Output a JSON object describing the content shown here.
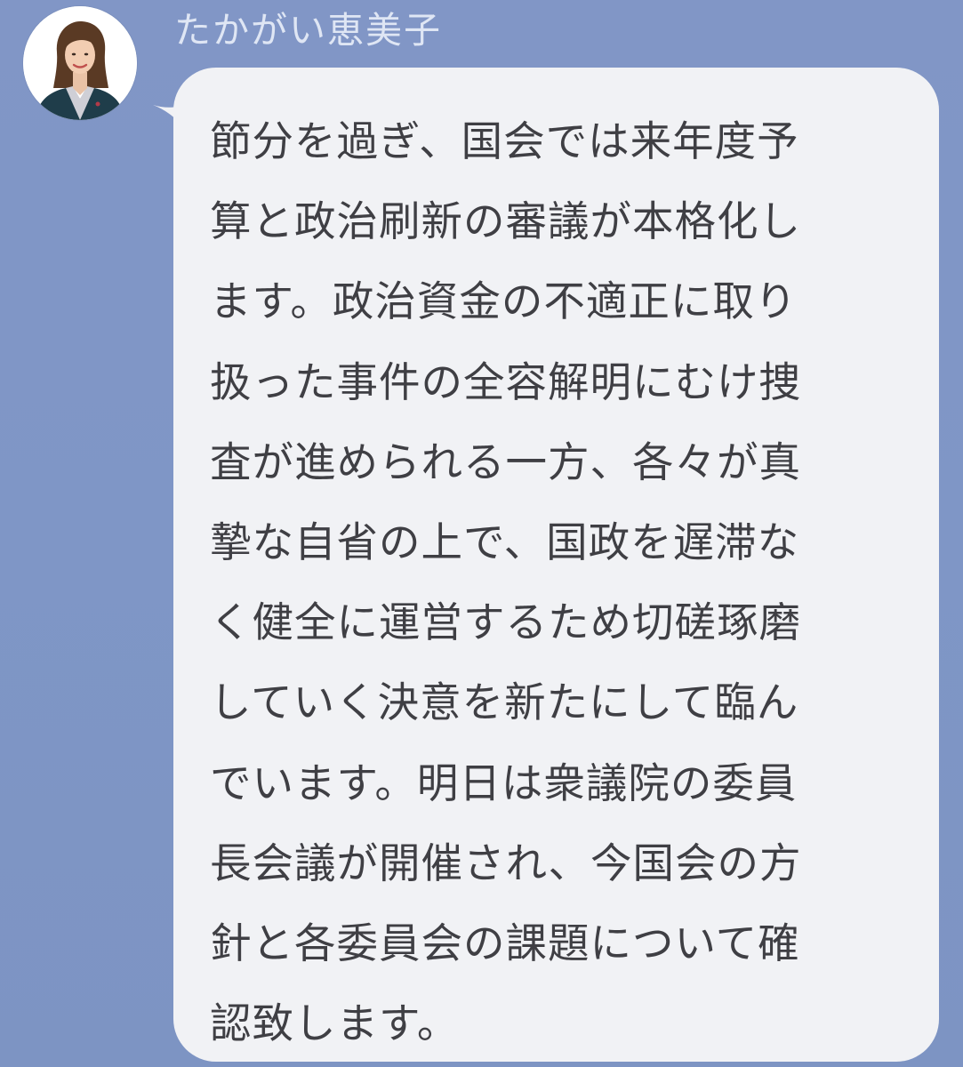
{
  "chat": {
    "sender_name": "たかがい恵美子",
    "message_lines": [
      "節分を過ぎ、国会では来年度予",
      "算と政治刷新の審議が本格化し",
      "ます。政治資金の不適正に取り",
      "扱った事件の全容解明にむけ捜",
      "査が進められる一方、各々が真",
      "摯な自省の上で、国政を遅滞な",
      "く健全に運営するため切磋琢磨",
      "していく決意を新たにして臨ん",
      "でいます。明日は衆議院の委員",
      "長会議が開催され、今国会の方",
      "針と各委員会の課題について確",
      "認致します。"
    ]
  },
  "avatar": {
    "icon": "profile-photo-icon"
  },
  "colors": {
    "background": "#7f96c6",
    "bubble": "#f1f2f5",
    "text": "#3f3f44",
    "sender_name": "#dfe6f4"
  }
}
